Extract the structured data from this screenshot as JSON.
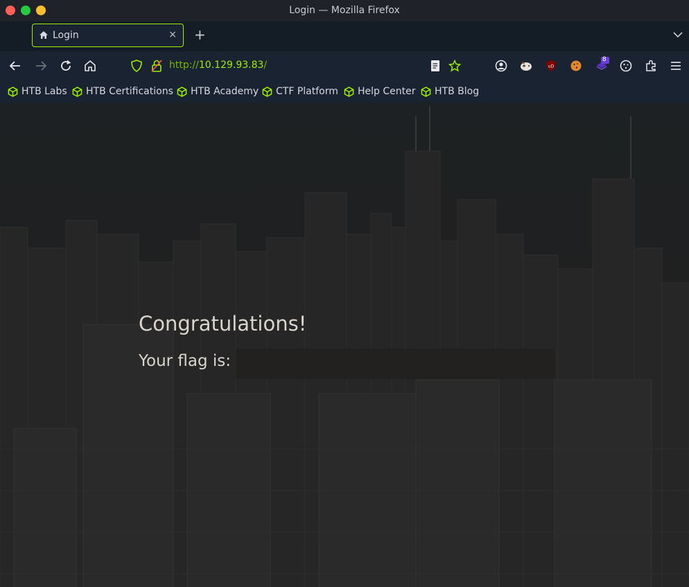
{
  "window": {
    "title": "Login — Mozilla Firefox"
  },
  "tab": {
    "label": "Login",
    "close": "×"
  },
  "newtab": "+",
  "nav": {
    "url_scheme": "http://",
    "url_host": "10.129.93.83",
    "url_path": "/"
  },
  "extensions": {
    "badge_count": "8"
  },
  "bookmarks": [
    {
      "label": "HTB Labs"
    },
    {
      "label": "HTB Certifications"
    },
    {
      "label": "HTB Academy"
    },
    {
      "label": "CTF Platform"
    },
    {
      "label": "Help Center"
    },
    {
      "label": "HTB Blog"
    }
  ],
  "page": {
    "heading": "Congratulations!",
    "flag_label": "Your flag is:",
    "flag_value": ""
  },
  "colors": {
    "accent": "#9fef00",
    "background": "#1b1f21",
    "toolbar": "#1a2332"
  }
}
